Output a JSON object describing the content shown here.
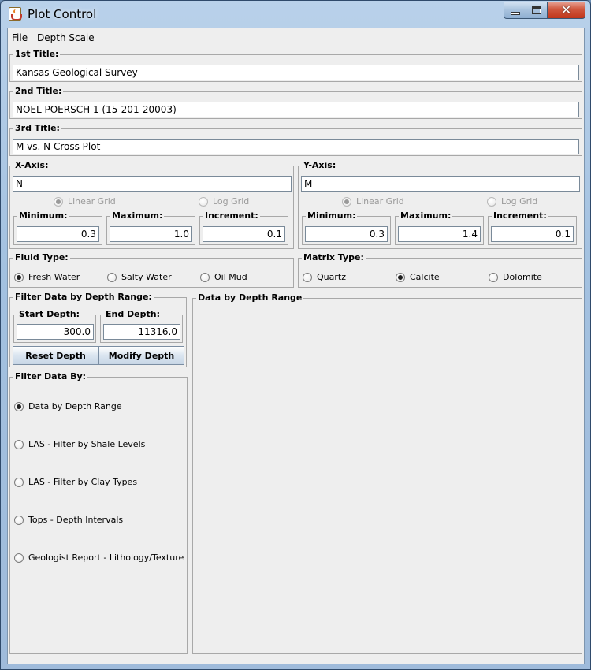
{
  "window": {
    "title": "Plot Control"
  },
  "menu": [
    {
      "label": "File"
    },
    {
      "label": "Depth Scale"
    }
  ],
  "titles": [
    {
      "label": "1st Title:",
      "value": "Kansas Geological Survey"
    },
    {
      "label": "2nd Title:",
      "value": "NOEL POERSCH 1 (15-201-20003)"
    },
    {
      "label": "3rd Title:",
      "value": "M vs. N Cross Plot"
    }
  ],
  "x_axis": {
    "label": "X-Axis:",
    "value": "N",
    "linear_grid": "Linear Grid",
    "log_grid": "Log Grid",
    "min_label": "Minimum:",
    "min": "0.3",
    "max_label": "Maximum:",
    "max": "1.0",
    "inc_label": "Increment:",
    "inc": "0.1"
  },
  "y_axis": {
    "label": "Y-Axis:",
    "value": "M",
    "linear_grid": "Linear Grid",
    "log_grid": "Log Grid",
    "min_label": "Minimum:",
    "min": "0.3",
    "max_label": "Maximum:",
    "max": "1.4",
    "inc_label": "Increment:",
    "inc": "0.1"
  },
  "fluid_type": {
    "label": "Fluid Type:",
    "options": [
      "Fresh Water",
      "Salty Water",
      "Oil Mud"
    ],
    "selected": "Fresh Water"
  },
  "matrix_type": {
    "label": "Matrix Type:",
    "options": [
      "Quartz",
      "Calcite",
      "Dolomite"
    ],
    "selected": "Calcite"
  },
  "depth_filter": {
    "label": "Filter Data by Depth Range:",
    "start_label": "Start Depth:",
    "start": "300.0",
    "end_label": "End Depth:",
    "end": "11316.0",
    "reset_button": "Reset Depth",
    "modify_button": "Modify Depth"
  },
  "filter_by": {
    "label": "Filter Data By:",
    "options": [
      "Data by Depth Range",
      "LAS - Filter by Shale Levels",
      "LAS - Filter by Clay Types",
      "Tops - Depth Intervals",
      "Geologist Report - Lithology/Texture"
    ],
    "selected": "Data by Depth Range"
  },
  "right_panel": {
    "label": "Data by Depth Range"
  }
}
